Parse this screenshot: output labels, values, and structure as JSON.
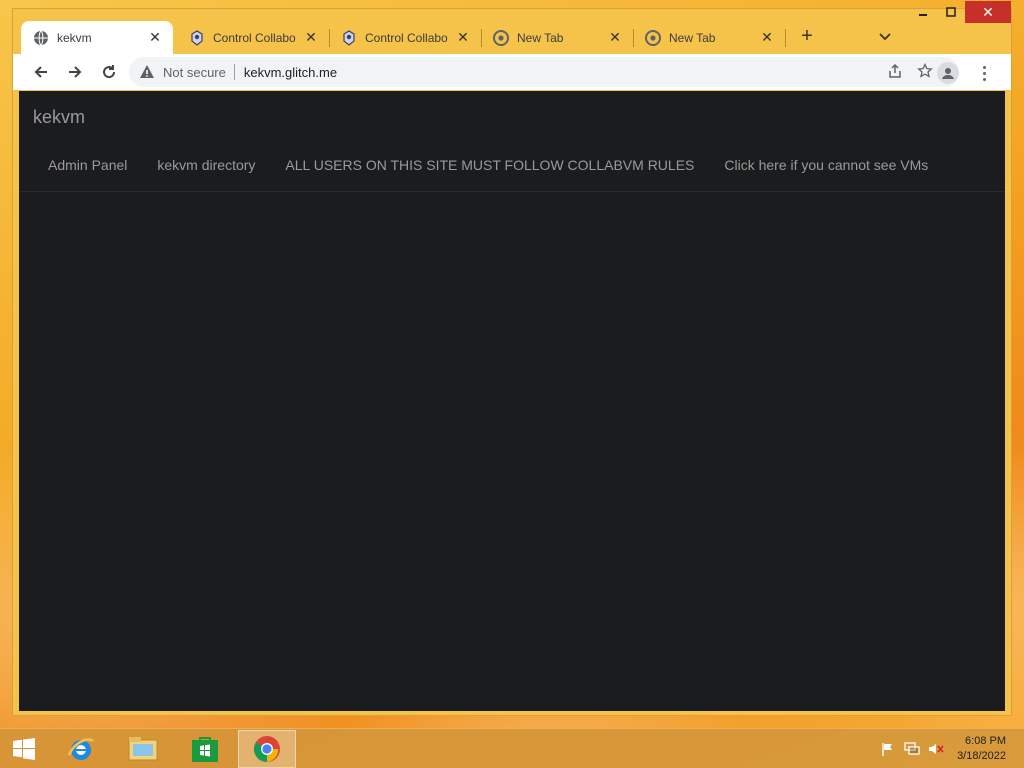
{
  "browser": {
    "tabs": [
      {
        "title": "kekvm",
        "icon": "globe-icon",
        "active": true
      },
      {
        "title": "Control Collabo",
        "icon": "collabvm-icon",
        "active": false
      },
      {
        "title": "Control Collabo",
        "icon": "collabvm-icon",
        "active": false
      },
      {
        "title": "New Tab",
        "icon": "chrome-icon",
        "active": false
      },
      {
        "title": "New Tab",
        "icon": "chrome-icon",
        "active": false
      }
    ],
    "new_tab_label": "+",
    "omnibox": {
      "security_text": "Not secure",
      "url": "kekvm.glitch.me"
    }
  },
  "site": {
    "brand": "kekvm",
    "nav_links": [
      "Admin Panel",
      "kekvm directory",
      "ALL USERS ON THIS SITE MUST FOLLOW COLLABVM RULES",
      "Click here if you cannot see VMs"
    ]
  },
  "taskbar": {
    "apps": [
      "internet-explorer",
      "file-explorer",
      "store",
      "chrome"
    ],
    "clock": {
      "time": "6:08 PM",
      "date": "3/18/2022"
    }
  },
  "colors": {
    "page_bg": "#1b1c1e",
    "nav_text": "#9a9a9a",
    "chrome_frame": "#f5c24a",
    "close_red": "#c7302a"
  }
}
